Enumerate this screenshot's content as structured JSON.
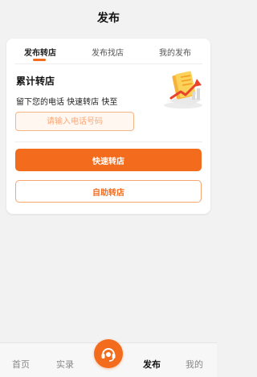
{
  "header": {
    "title": "发布"
  },
  "card": {
    "tabs": [
      "发布转店",
      "发布找店",
      "我的发布"
    ],
    "active_tab": 0,
    "stat_title": "累计转店",
    "sub_text": "留下您的电话 快速转店 快至",
    "phone_placeholder": "请输入电话号码",
    "quick_button": "快速转店",
    "self_button": "自助转店"
  },
  "tabbar": {
    "items": [
      "首页",
      "实录",
      "发布",
      "我的"
    ],
    "active": 2,
    "center_icon": "headset-icon"
  },
  "colors": {
    "accent": "#f36b1c",
    "accent_light": "#f6a87a",
    "background": "#f2f2f2"
  }
}
